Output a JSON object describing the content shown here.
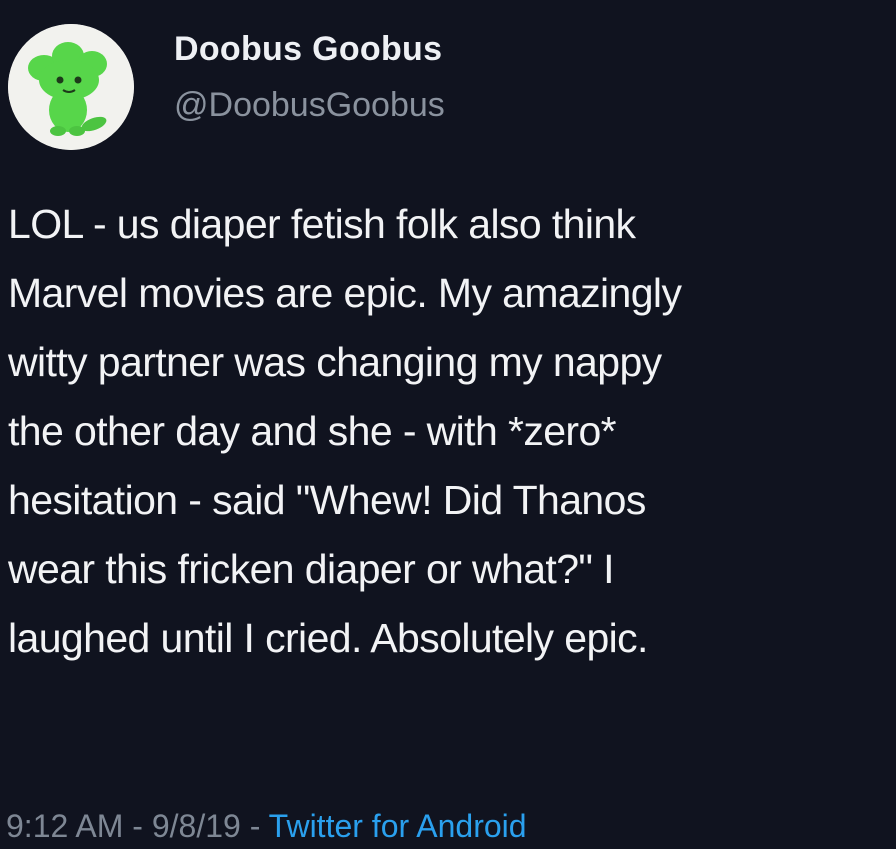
{
  "tweet": {
    "display_name": "Doobus Goobus",
    "handle": "@DoobusGoobus",
    "avatar_icon": "green-creature-avatar-icon",
    "body": "LOL - us diaper fetish folk also think\nMarvel movies are epic. My amazingly\nwitty partner was changing my nappy\nthe other day and she - with *zero*\nhesitation - said \"Whew! Did Thanos\nwear this fricken diaper or what?\" I\nlaughed until I cried. Absolutely epic.",
    "time": "9:12 AM",
    "separator": " - ",
    "date": "9/8/19",
    "separator2": " - ",
    "source": "Twitter for Android"
  },
  "colors": {
    "background": "#10131f",
    "text": "#f2f3f5",
    "muted": "#7e8794",
    "link": "#2aa0ee",
    "avatar_green": "#57d64a"
  }
}
